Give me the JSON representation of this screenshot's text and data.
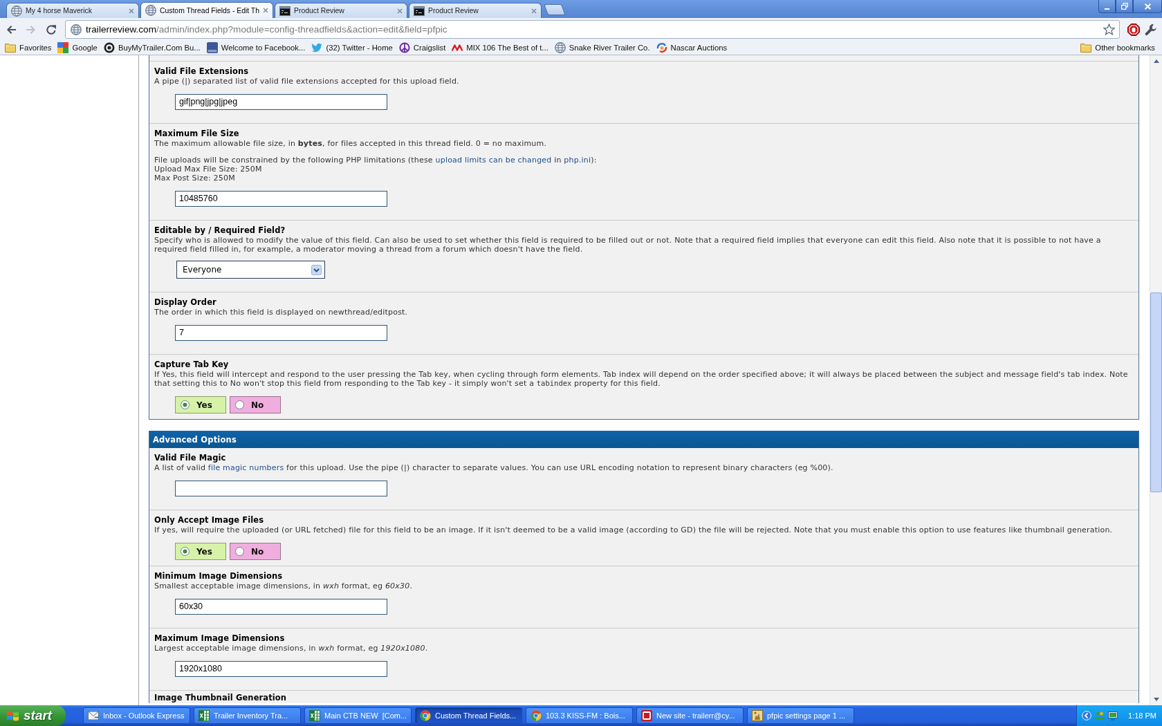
{
  "browser": {
    "tabs": [
      {
        "title": "My 4 horse Maverick",
        "selected": false
      },
      {
        "title": "Custom Thread Fields - Edit Th",
        "selected": true
      },
      {
        "title": "Product Review",
        "selected": false
      },
      {
        "title": "Product Review",
        "selected": false
      }
    ],
    "forward_disabled": true,
    "address": {
      "host": "trailerreview.com",
      "path": "/admin/index.php?module=config-threadfields&action=edit&field=pfpic"
    },
    "bookmarks": [
      {
        "label": "Favorites"
      },
      {
        "label": "Google"
      },
      {
        "label": "BuyMyTrailer.Com Bu..."
      },
      {
        "label": "Welcome to Facebook..."
      },
      {
        "label": "(32) Twitter - Home"
      },
      {
        "label": "Craigslist"
      },
      {
        "label": "MIX 106 The Best of t..."
      },
      {
        "label": "Snake River Trailer Co."
      },
      {
        "label": "Nascar Auctions"
      }
    ],
    "other_bookmarks": "Other bookmarks"
  },
  "sections": [
    {
      "rows": [
        {
          "kind": "text",
          "title": "Valid File Extensions",
          "description": [
            [
              {
                "kind": "plain",
                "text": "A pipe (|) separated list of valid file extensions accepted for this upload field."
              }
            ]
          ],
          "value": "gif|png|jpg|jpeg"
        },
        {
          "kind": "text",
          "title": "Maximum File Size",
          "description": [
            [
              {
                "kind": "plain",
                "text": "The maximum allowable file size, in "
              },
              {
                "kind": "bold",
                "text": "bytes"
              },
              {
                "kind": "plain",
                "text": ", for files accepted in this thread field. 0 = no maximum."
              }
            ],
            [
              {
                "kind": "plain",
                "text": "File uploads will be constrained by the following PHP limitations (these "
              },
              {
                "kind": "link",
                "text": "upload limits can be changed"
              },
              {
                "kind": "plain",
                "text": " in "
              },
              {
                "kind": "link",
                "text": "php.ini"
              },
              {
                "kind": "plain",
                "text": "):"
              }
            ]
          ],
          "limits": [
            "Upload Max File Size: 250M",
            "Max Post Size: 250M"
          ],
          "value": "10485760"
        },
        {
          "kind": "select",
          "title": "Editable by / Required Field?",
          "description": [
            [
              {
                "kind": "plain",
                "text": "Specify who is allowed to modify the value of this field. Can also be used to set whether this field is required to be filled out or not. Note that a required field implies that everyone can edit this field. Also note that it is possible to not have a required field filled in, for example, a moderator moving a thread from a forum which doesn't have the field."
              }
            ]
          ],
          "value": "Everyone"
        },
        {
          "kind": "text",
          "title": "Display Order",
          "description": [
            [
              {
                "kind": "plain",
                "text": "The order in which this field is displayed on newthread/editpost."
              }
            ]
          ],
          "value": "7"
        },
        {
          "kind": "yesno",
          "title": "Capture Tab Key",
          "description": [
            [
              {
                "kind": "plain",
                "text": "If Yes, this field will intercept and respond to the user pressing the Tab key, when cycling through form elements. Tab index will depend on the order specified above; it will always be placed between the subject and message field's tab index. Note that setting this to No won't stop this field from responding to the Tab key - it simply won't set a "
              },
              {
                "kind": "code",
                "text": "tabindex"
              },
              {
                "kind": "plain",
                "text": " property for this field."
              }
            ]
          ],
          "options": [
            {
              "label": "Yes",
              "selected": true,
              "color": "#d6f2a8"
            },
            {
              "label": "No",
              "selected": false,
              "color": "#f0aede"
            }
          ]
        }
      ]
    },
    {
      "title": "Advanced Options",
      "rows": [
        {
          "kind": "text",
          "title": "Valid File Magic",
          "description": [
            [
              {
                "kind": "plain",
                "text": "A list of valid "
              },
              {
                "kind": "link",
                "text": "file magic numbers"
              },
              {
                "kind": "plain",
                "text": " for this upload. Use the pipe (|) character to separate values. You can use URL encoding notation to represent binary characters (eg %00)."
              }
            ]
          ]
        },
        {
          "kind": "yesno",
          "title": "Only Accept Image Files",
          "description": [
            [
              {
                "kind": "plain",
                "text": "If yes, will require the uploaded (or URL fetched) file for this field to be an image. If it isn't deemed to be a valid image (according to GD) the file will be rejected. Note that you must enable this option to use features like thumbnail generation."
              }
            ]
          ],
          "options": [
            {
              "label": "Yes",
              "selected": true,
              "color": "#d6f2a8"
            },
            {
              "label": "No",
              "selected": false,
              "color": "#f0aede"
            }
          ]
        },
        {
          "kind": "text",
          "title": "Minimum Image Dimensions",
          "description": [
            [
              {
                "kind": "plain",
                "text": "Smallest acceptable image dimensions, in "
              },
              {
                "kind": "italic",
                "text": "wxh"
              },
              {
                "kind": "plain",
                "text": " format, eg "
              },
              {
                "kind": "italic",
                "text": "60x30"
              },
              {
                "kind": "plain",
                "text": "."
              }
            ]
          ],
          "value": "60x30"
        },
        {
          "kind": "text",
          "title": "Maximum Image Dimensions",
          "description": [
            [
              {
                "kind": "plain",
                "text": "Largest acceptable image dimensions, in "
              },
              {
                "kind": "italic",
                "text": "wxh"
              },
              {
                "kind": "plain",
                "text": " format, eg "
              },
              {
                "kind": "italic",
                "text": "1920x1080"
              },
              {
                "kind": "plain",
                "text": "."
              }
            ]
          ],
          "value": "1920x1080"
        },
        {
          "title": "Image Thumbnail Generation"
        }
      ]
    }
  ],
  "taskbar": {
    "start": "start",
    "items": [
      {
        "label": "Inbox - Outlook Express",
        "selected": false
      },
      {
        "label": "Trailer Inventory Tra...",
        "selected": false
      },
      {
        "label": "Main CTB NEW  [Com...",
        "selected": false
      },
      {
        "label": "Custom Thread Fields...",
        "selected": true
      },
      {
        "label": "103.3 KISS-FM : Bois...",
        "selected": false
      },
      {
        "label": "New site - trailerr@cy...",
        "selected": false
      },
      {
        "label": "pfpic settings page 1 ...",
        "selected": false
      }
    ],
    "clock": "1:18 PM"
  }
}
